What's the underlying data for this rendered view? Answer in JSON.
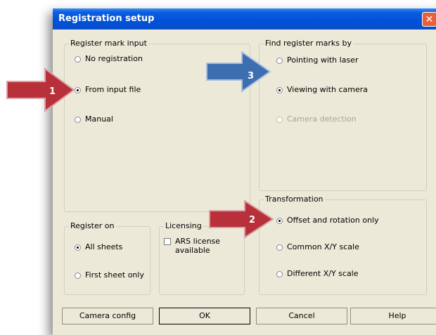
{
  "window": {
    "title": "Registration setup",
    "close_glyph": "✕"
  },
  "register_mark_input": {
    "legend": "Register mark input",
    "options": [
      "No registration",
      "From input file",
      "Manual"
    ],
    "selected": "From input file"
  },
  "find_register_marks": {
    "legend": "Find register marks by",
    "options": [
      "Pointing with laser",
      "Viewing with camera",
      "Camera detection"
    ],
    "selected": "Viewing with camera",
    "disabled": [
      "Camera detection"
    ]
  },
  "transformation": {
    "legend": "Transformation",
    "options": [
      "Offset and rotation only",
      "Common X/Y scale",
      "Different X/Y scale"
    ],
    "selected": "Offset and rotation only"
  },
  "register_on": {
    "legend": "Register on",
    "options": [
      "All sheets",
      "First sheet only"
    ],
    "selected": "All sheets"
  },
  "licensing": {
    "legend": "Licensing",
    "checkbox_label_line1": "ARS license",
    "checkbox_label_line2": "available",
    "checked": false
  },
  "buttons": {
    "camera_config": "Camera config",
    "ok": "OK",
    "cancel": "Cancel",
    "help": "Help"
  },
  "callouts": {
    "arrow1": "1",
    "arrow2": "2",
    "arrow3": "3"
  },
  "colors": {
    "red_arrow": "#b8303a",
    "blue_arrow": "#3d6fb0",
    "titlebar": "#0a5fe0",
    "dialog_bg": "#ece9d8"
  }
}
